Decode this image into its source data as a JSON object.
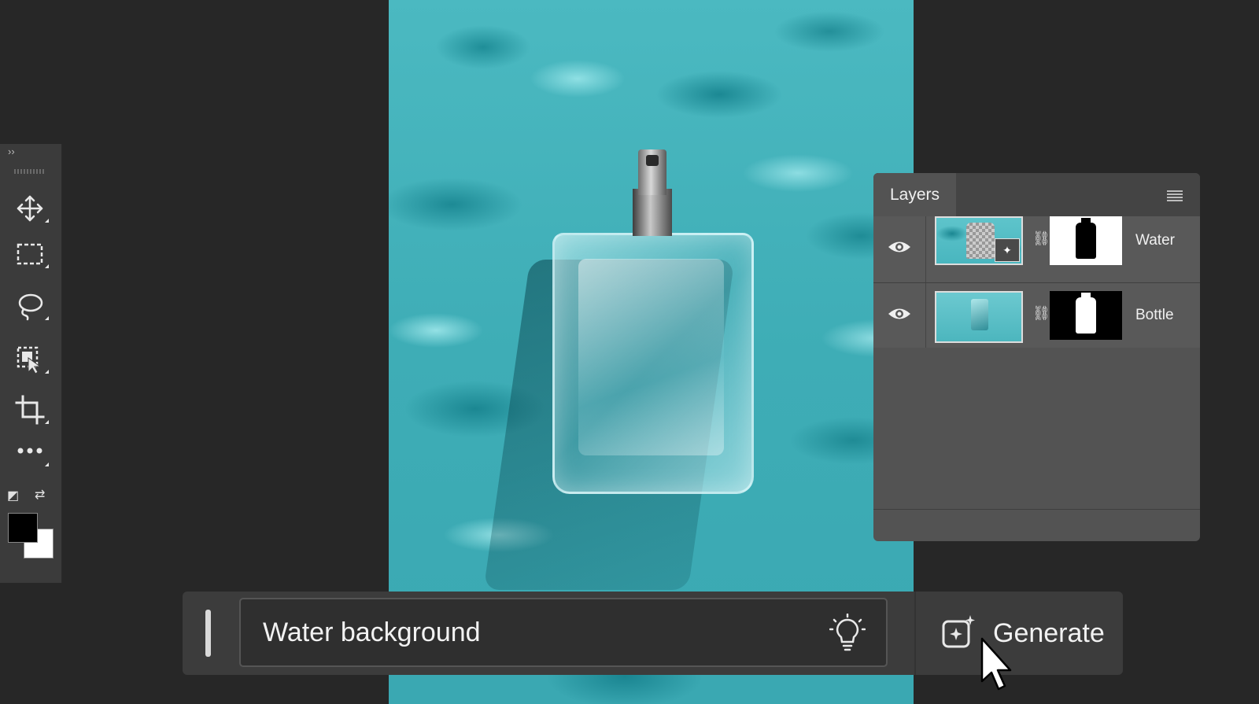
{
  "layers_panel": {
    "title": "Layers",
    "layers": [
      {
        "name": "Water",
        "visible": true
      },
      {
        "name": "Bottle",
        "visible": true
      }
    ]
  },
  "generate_bar": {
    "prompt_value": "Water background",
    "generate_label": "Generate"
  },
  "toolbar": {
    "tools": [
      "move-icon",
      "rectangular-marquee-icon",
      "lasso-icon",
      "object-selection-icon",
      "crop-icon",
      "more-tools-icon"
    ],
    "foreground_color": "#000000",
    "background_color": "#ffffff"
  },
  "colors": {
    "panel": "#535353",
    "app_background": "#272727",
    "canvas_water": "#3eadb6"
  }
}
